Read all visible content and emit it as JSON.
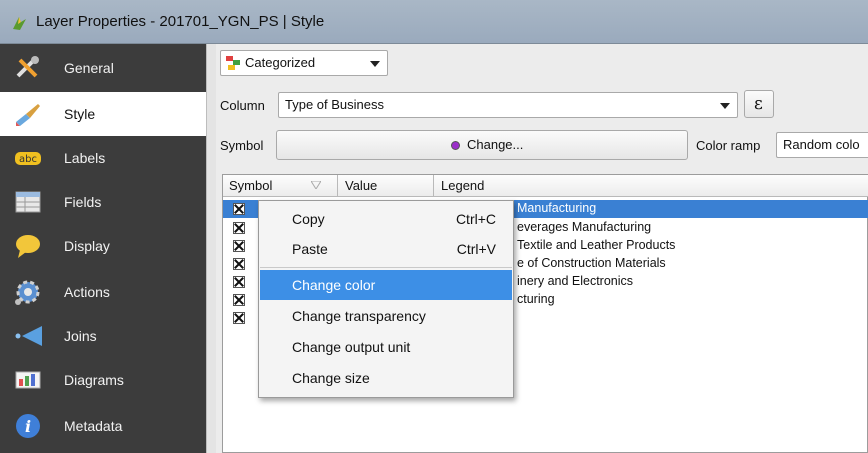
{
  "window": {
    "title": "Layer Properties - 201701_YGN_PS | Style"
  },
  "sidebar": {
    "items": [
      {
        "label": "General",
        "icon": "general-tools-icon"
      },
      {
        "label": "Style",
        "icon": "style-brush-icon",
        "active": true
      },
      {
        "label": "Labels",
        "icon": "labels-abc-icon"
      },
      {
        "label": "Fields",
        "icon": "fields-table-icon"
      },
      {
        "label": "Display",
        "icon": "display-bubble-icon"
      },
      {
        "label": "Actions",
        "icon": "actions-gear-icon"
      },
      {
        "label": "Joins",
        "icon": "joins-arrow-icon"
      },
      {
        "label": "Diagrams",
        "icon": "diagrams-chart-icon"
      },
      {
        "label": "Metadata",
        "icon": "metadata-info-icon"
      }
    ]
  },
  "style": {
    "renderer": "Categorized",
    "column_label": "Column",
    "column_value": "Type of Business",
    "expression_button": "ε",
    "symbol_label": "Symbol",
    "change_button": "Change...",
    "color_ramp_label": "Color ramp",
    "color_ramp_value": "Random colo"
  },
  "table": {
    "headers": [
      "Symbol",
      "Value",
      "Legend"
    ],
    "rows": [
      {
        "legend": "Manufacturing",
        "selected": true
      },
      {
        "legend": "everages Manufacturing"
      },
      {
        "legend": "Textile and Leather Products"
      },
      {
        "legend": "e of Construction Materials"
      },
      {
        "legend": "inery and Electronics"
      },
      {
        "legend": "cturing"
      },
      {
        "legend": ""
      }
    ]
  },
  "context_menu": {
    "items": [
      {
        "label": "Copy",
        "shortcut": "Ctrl+C"
      },
      {
        "label": "Paste",
        "shortcut": "Ctrl+V"
      },
      {
        "label": "Change color",
        "shortcut": "",
        "highlighted": true
      },
      {
        "label": "Change transparency",
        "shortcut": ""
      },
      {
        "label": "Change output unit",
        "shortcut": ""
      },
      {
        "label": "Change size",
        "shortcut": ""
      }
    ]
  },
  "colors": {
    "sidebar_bg": "#3c3c3c",
    "selection": "#3a80d3",
    "menu_highlight": "#3d8fe6",
    "symbol_dot": "#9b2fc9"
  }
}
